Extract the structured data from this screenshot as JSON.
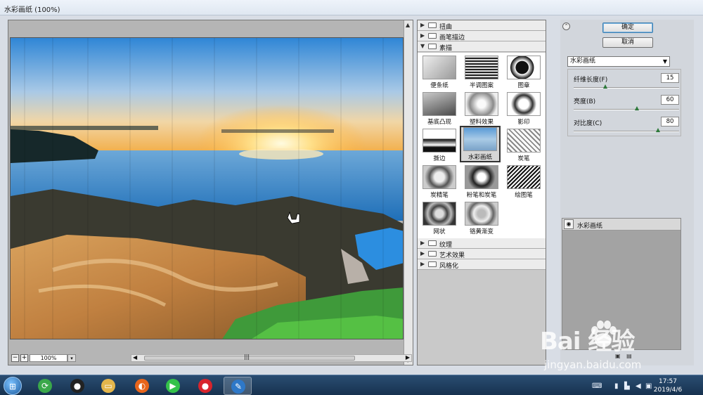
{
  "window": {
    "title": "水彩画纸 (100%)"
  },
  "canvas": {
    "zoom": "100%",
    "zoom_minus": "−",
    "zoom_plus": "+",
    "zoom_dropdown": "▾",
    "scroll_grip": "|||"
  },
  "filter_gallery": {
    "folders_top": [
      {
        "name": "扭曲",
        "expanded": false
      },
      {
        "name": "画笔描边",
        "expanded": false
      },
      {
        "name": "素描",
        "expanded": true
      }
    ],
    "thumbnails": [
      {
        "label": "便条纸"
      },
      {
        "label": "半调图案"
      },
      {
        "label": "图章"
      },
      {
        "label": "基底凸现"
      },
      {
        "label": "塑料效果"
      },
      {
        "label": "影印"
      },
      {
        "label": "撕边"
      },
      {
        "label": "水彩画纸",
        "selected": true
      },
      {
        "label": "炭笔"
      },
      {
        "label": "炭精笔"
      },
      {
        "label": "粉笔和炭笔"
      },
      {
        "label": "绘图笔"
      },
      {
        "label": "网状"
      },
      {
        "label": "铬黄渐变"
      }
    ],
    "folders_bottom": [
      {
        "name": "纹理",
        "expanded": false
      },
      {
        "name": "艺术效果",
        "expanded": false
      },
      {
        "name": "风格化",
        "expanded": false
      }
    ]
  },
  "settings": {
    "ok_label": "确定",
    "cancel_label": "取消",
    "filter_select": "水彩画纸",
    "params": [
      {
        "label": "纤维长度(F)",
        "value": "15",
        "fraction": 0.3
      },
      {
        "label": "亮度(B)",
        "value": "60",
        "fraction": 0.6
      },
      {
        "label": "对比度(C)",
        "value": "80",
        "fraction": 0.8
      }
    ],
    "layer": {
      "name": "水彩画纸"
    }
  },
  "taskbar": {
    "time": "17:57",
    "date": "2019/4/6",
    "apps": [
      {
        "icon": "circle-arrows-icon",
        "color": "#3aa84a"
      },
      {
        "icon": "qq-penguin-icon",
        "color": "#222222"
      },
      {
        "icon": "folder-icon",
        "color": "#e4b64c"
      },
      {
        "icon": "firefox-icon",
        "color": "#e8651c"
      },
      {
        "icon": "media-icon",
        "color": "#34c24a"
      },
      {
        "icon": "record-icon",
        "color": "#d8242c"
      },
      {
        "icon": "photoshop-feather-icon",
        "color": "#2e78c8"
      }
    ]
  },
  "watermark": {
    "brand": "Bai  经验",
    "url": "jingyan.baidu.com"
  }
}
